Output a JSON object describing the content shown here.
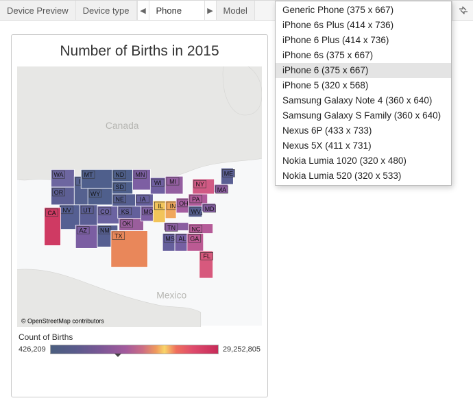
{
  "toolbar": {
    "device_preview": "Device Preview",
    "device_type_label": "Device type",
    "device_type_value": "Phone",
    "model_label": "Model"
  },
  "dropdown": {
    "items": [
      "Generic Phone (375 x 667)",
      "iPhone 6s Plus (414 x 736)",
      "iPhone 6 Plus (414 x 736)",
      "iPhone 6s (375 x 667)",
      "iPhone 6 (375 x 667)",
      "iPhone 5 (320 x 568)",
      "Samsung Galaxy Note 4 (360 x 640)",
      "Samsung Galaxy S Family (360 x 640)",
      "Nexus 6P (433 x 733)",
      "Nexus 5X (411 x 731)",
      "Nokia Lumia 1020 (320 x 480)",
      "Nokia Lumia 520 (320 x 533)"
    ],
    "selected_index": 4
  },
  "viz": {
    "title": "Number of Births in 2015",
    "basemap": {
      "country_labels": [
        "Canada",
        "Mexico"
      ]
    },
    "attribution": "© OpenStreetMap contributors",
    "state_labels": [
      "WA",
      "MT",
      "ND",
      "MN",
      "OR",
      "ID",
      "SD",
      "WI",
      "MI",
      "ME",
      "WY",
      "NE",
      "IA",
      "NY",
      "MA",
      "NV",
      "UT",
      "CO",
      "KS",
      "MO",
      "IL",
      "IN",
      "OH",
      "PA",
      "WV",
      "MD",
      "AZ",
      "NM",
      "OK",
      "TN",
      "NC",
      "TX",
      "MS",
      "AL",
      "GA",
      "FL"
    ]
  },
  "legend": {
    "title": "Count of Births",
    "min_label": "426,209",
    "max_label": "29,252,805"
  },
  "chart_data": {
    "type": "heatmap",
    "title": "Number of Births in 2015",
    "color_field": "Count of Births",
    "color_range": [
      426209,
      29252805
    ],
    "geography": "US States",
    "note": "State-level choropleth. Exact per-state values are not labeled; colors encode Count of Births within the range shown in the legend."
  }
}
